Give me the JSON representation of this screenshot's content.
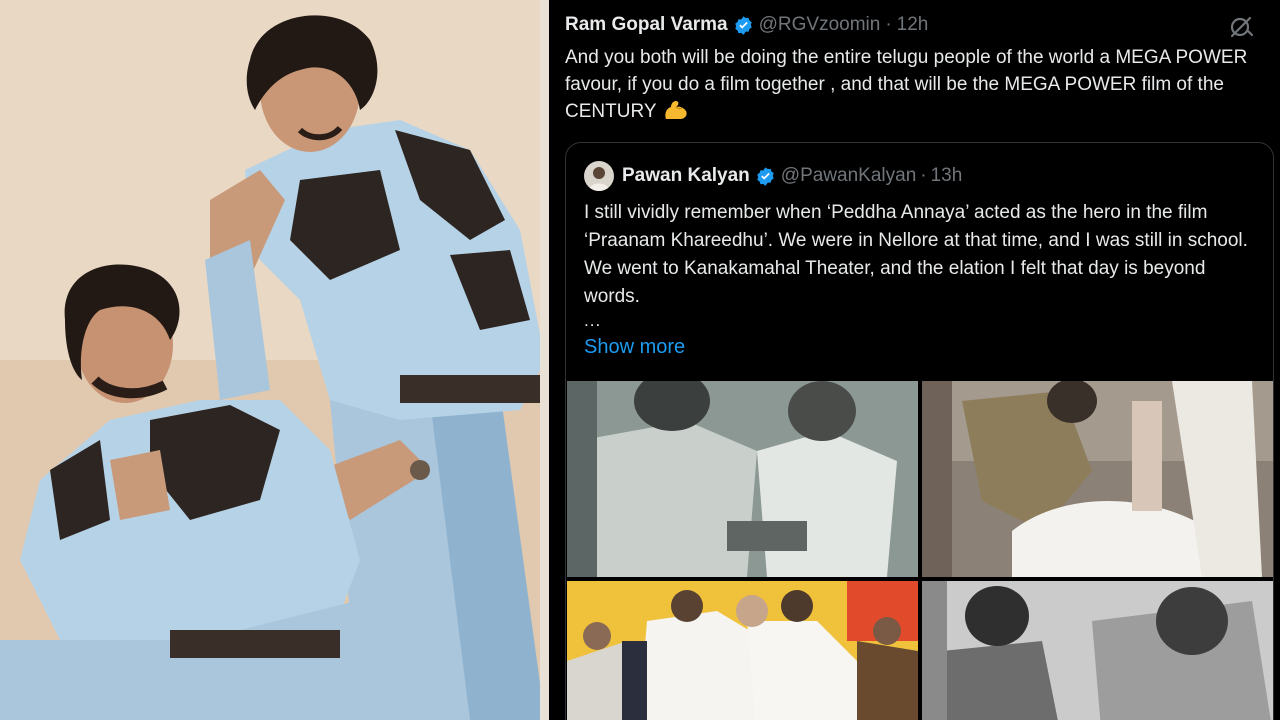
{
  "tweet": {
    "author_name": "Ram Gopal Varma",
    "handle": "@RGVzoomin",
    "separator": "·",
    "time": "12h",
    "text": "And you both will be doing the entire telugu people of the world  a MEGA POWER favour,  if you do a film together , and that will be the MEGA POWER film of the CENTURY",
    "emoji": "flexed-biceps",
    "grok_icon": "grok-icon"
  },
  "quoted_tweet": {
    "author_name": "Pawan Kalyan",
    "handle": "@PawanKalyan",
    "separator": "·",
    "time": "13h",
    "text": "I still vividly remember when ‘Peddha Annaya’ acted as the hero in the film ‘Praanam Khareedhu’. We were in Nellore at that time, and I was still in school. We went to Kanakamahal Theater, and the elation I felt that day is beyond words.",
    "ellipsis": "...",
    "show_more": "Show more",
    "media": [
      {
        "name": "vintage-photo-two-boys"
      },
      {
        "name": "photo-touching-feet"
      },
      {
        "name": "photo-embrace-event"
      },
      {
        "name": "vintage-photo-child-and-man"
      }
    ]
  },
  "colors": {
    "background": "#000000",
    "text": "#e7e9ea",
    "muted": "#71767b",
    "link": "#1d9bf0",
    "verified": "#1d9bf0",
    "border": "#2f3336"
  }
}
